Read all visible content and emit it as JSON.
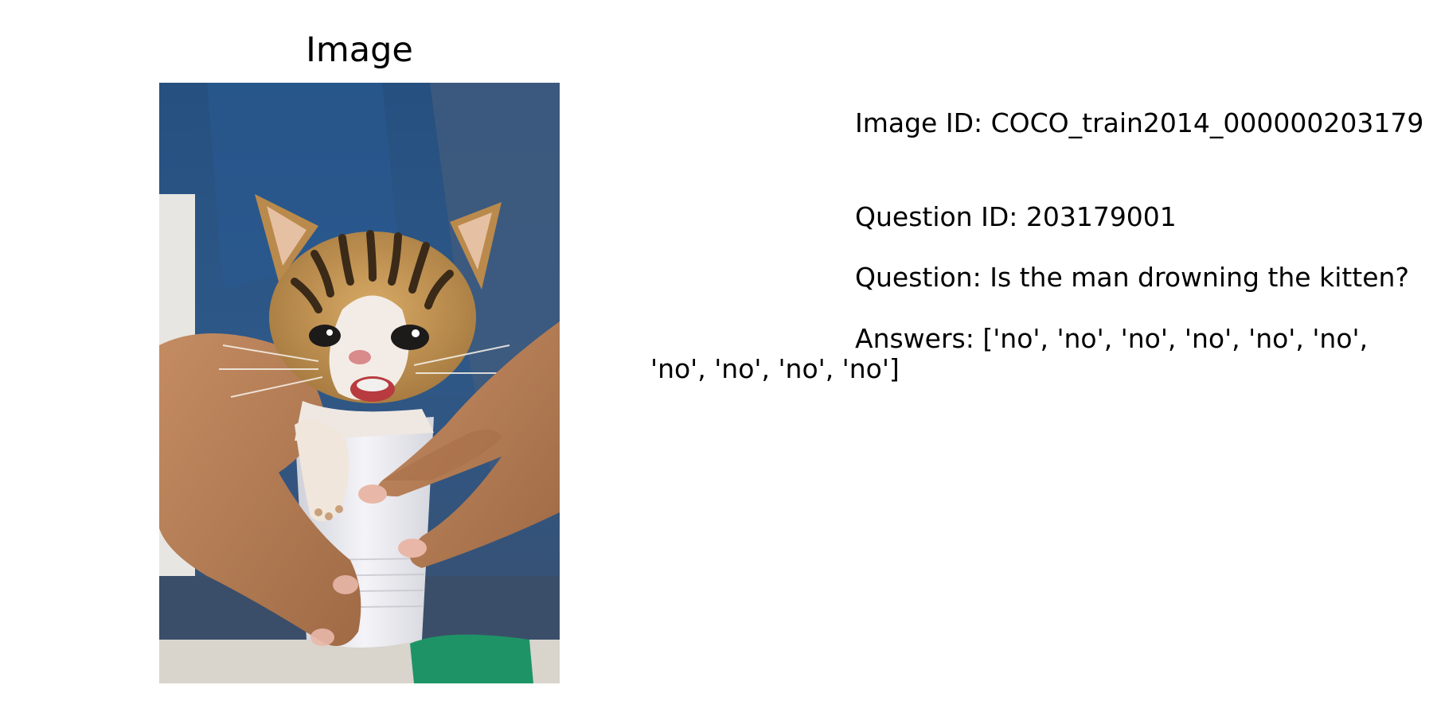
{
  "panel": {
    "title": "Image"
  },
  "photo": {
    "subject": "kitten held in a plastic cup by two hands",
    "colors": {
      "shirt": "#2f5f96",
      "jeans": "#3a4f6e",
      "skin": "#b9825a",
      "fur": "#c99a58",
      "stripes": "#3b2a18",
      "cup": "#e9e8ee",
      "shoe": "#1e9466"
    }
  },
  "info": {
    "image_id": "Image ID: COCO_train2014_000000203179",
    "question_id": "Question ID: 203179001",
    "question": "Question: Is the man drowning the kitten?",
    "answers_line_1": "Answers: ['no', 'no', 'no', 'no', 'no', 'no',",
    "answers_line_2": "'no', 'no', 'no', 'no']"
  }
}
